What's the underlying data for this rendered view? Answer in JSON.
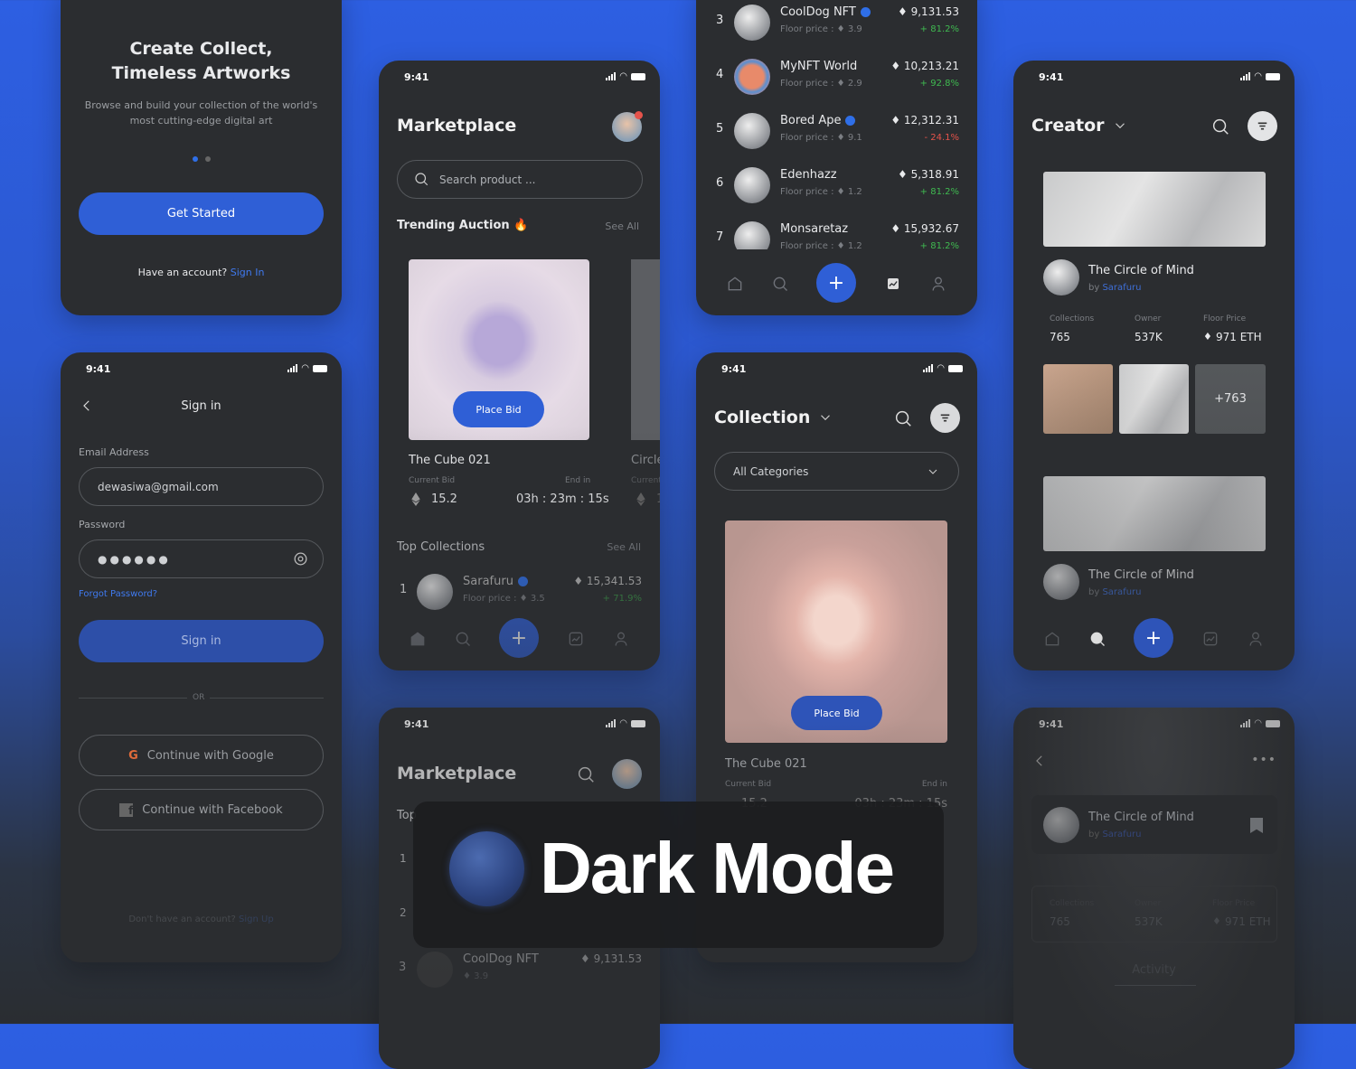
{
  "colors": {
    "accent": "#2f5fd6",
    "background": "#2b2d30",
    "positive": "#3fb950",
    "negative": "#e5534b"
  },
  "status": {
    "time": "9:41"
  },
  "welcome": {
    "title_line1": "Create Collect,",
    "title_line2": "Timeless Artworks",
    "subtitle_line1": "Browse and build your collection of the world's",
    "subtitle_line2": "most cutting-edge digital art",
    "get_started": "Get Started",
    "have_account": "Have an account?",
    "sign_in_link": "Sign In",
    "page_index": 1,
    "page_count": 2
  },
  "signin": {
    "title": "Sign in",
    "email_label": "Email Address",
    "email_value": "dewasiwa@gmail.com",
    "password_label": "Password",
    "password_value": "●●●●●●",
    "forgot": "Forgot Password?",
    "submit": "Sign in",
    "or": "OR",
    "google": "Continue with Google",
    "facebook": "Continue with Facebook",
    "no_account": "Don't have an account?",
    "sign_up": "Sign Up"
  },
  "marketplace": {
    "title": "Marketplace",
    "search_placeholder": "Search product ...",
    "trending": "Trending Auction",
    "see_all": "See All",
    "place_bid": "Place Bid",
    "card": {
      "name": "The Cube 021",
      "bid_label": "Current Bid",
      "bid": "15.2",
      "end_label": "End in",
      "end": "03h : 23m : 15s"
    },
    "card2": {
      "name": "Circle",
      "bid_label": "Current",
      "bid": "1"
    },
    "top_collections": "Top Collections",
    "top": [
      {
        "rank": "1",
        "name": "Sarafuru",
        "floor": "3.5",
        "price": "15,341.53",
        "change": "+ 71.9%"
      }
    ]
  },
  "floor_label": "Floor price :",
  "ranking": [
    {
      "rank": "3",
      "name": "CoolDog NFT",
      "verified": true,
      "floor": "3.9",
      "price": "9,131.53",
      "change": "+ 81.2%",
      "trend": "up"
    },
    {
      "rank": "4",
      "name": "MyNFT World",
      "verified": false,
      "floor": "2.9",
      "price": "10,213.21",
      "change": "+ 92.8%",
      "trend": "up"
    },
    {
      "rank": "5",
      "name": "Bored Ape",
      "verified": true,
      "floor": "9.1",
      "price": "12,312.31",
      "change": "- 24.1%",
      "trend": "down"
    },
    {
      "rank": "6",
      "name": "Edenhazz",
      "verified": false,
      "floor": "1.2",
      "price": "5,318.91",
      "change": "+ 81.2%",
      "trend": "up"
    },
    {
      "rank": "7",
      "name": "Monsaretaz",
      "verified": false,
      "floor": "1.2",
      "price": "15,932.67",
      "change": "+ 81.2%",
      "trend": "up"
    }
  ],
  "collection": {
    "title": "Collection",
    "dropdown": "All Categories",
    "place_bid": "Place Bid",
    "name": "The Cube 021",
    "bid_label": "Current Bid",
    "end_label": "End in",
    "bid": "15.2",
    "end": "03h : 23m : 15s"
  },
  "creator": {
    "title": "Creator",
    "items": [
      {
        "name": "The Circle of Mind",
        "by": "by",
        "author": "Sarafuru"
      },
      {
        "name": "The Circle of Mind",
        "by": "by",
        "author": "Sarafuru"
      }
    ],
    "stats": [
      {
        "label": "Collections",
        "value": "765"
      },
      {
        "label": "Owner",
        "value": "537K"
      },
      {
        "label": "Floor Price",
        "value": "971 ETH"
      }
    ],
    "more_count": "+763"
  },
  "market2": {
    "title": "Marketplace",
    "top": "Top",
    "rows": [
      {
        "rank": "1"
      },
      {
        "rank": "2"
      },
      {
        "rank": "3",
        "name": "CoolDog NFT",
        "floor": "3.9",
        "price": "9,131.53"
      }
    ]
  },
  "detail": {
    "name": "The Circle of Mind",
    "by": "by",
    "author": "Sarafuru",
    "activity": "Activity"
  },
  "banner": {
    "title": "Dark Mode"
  }
}
